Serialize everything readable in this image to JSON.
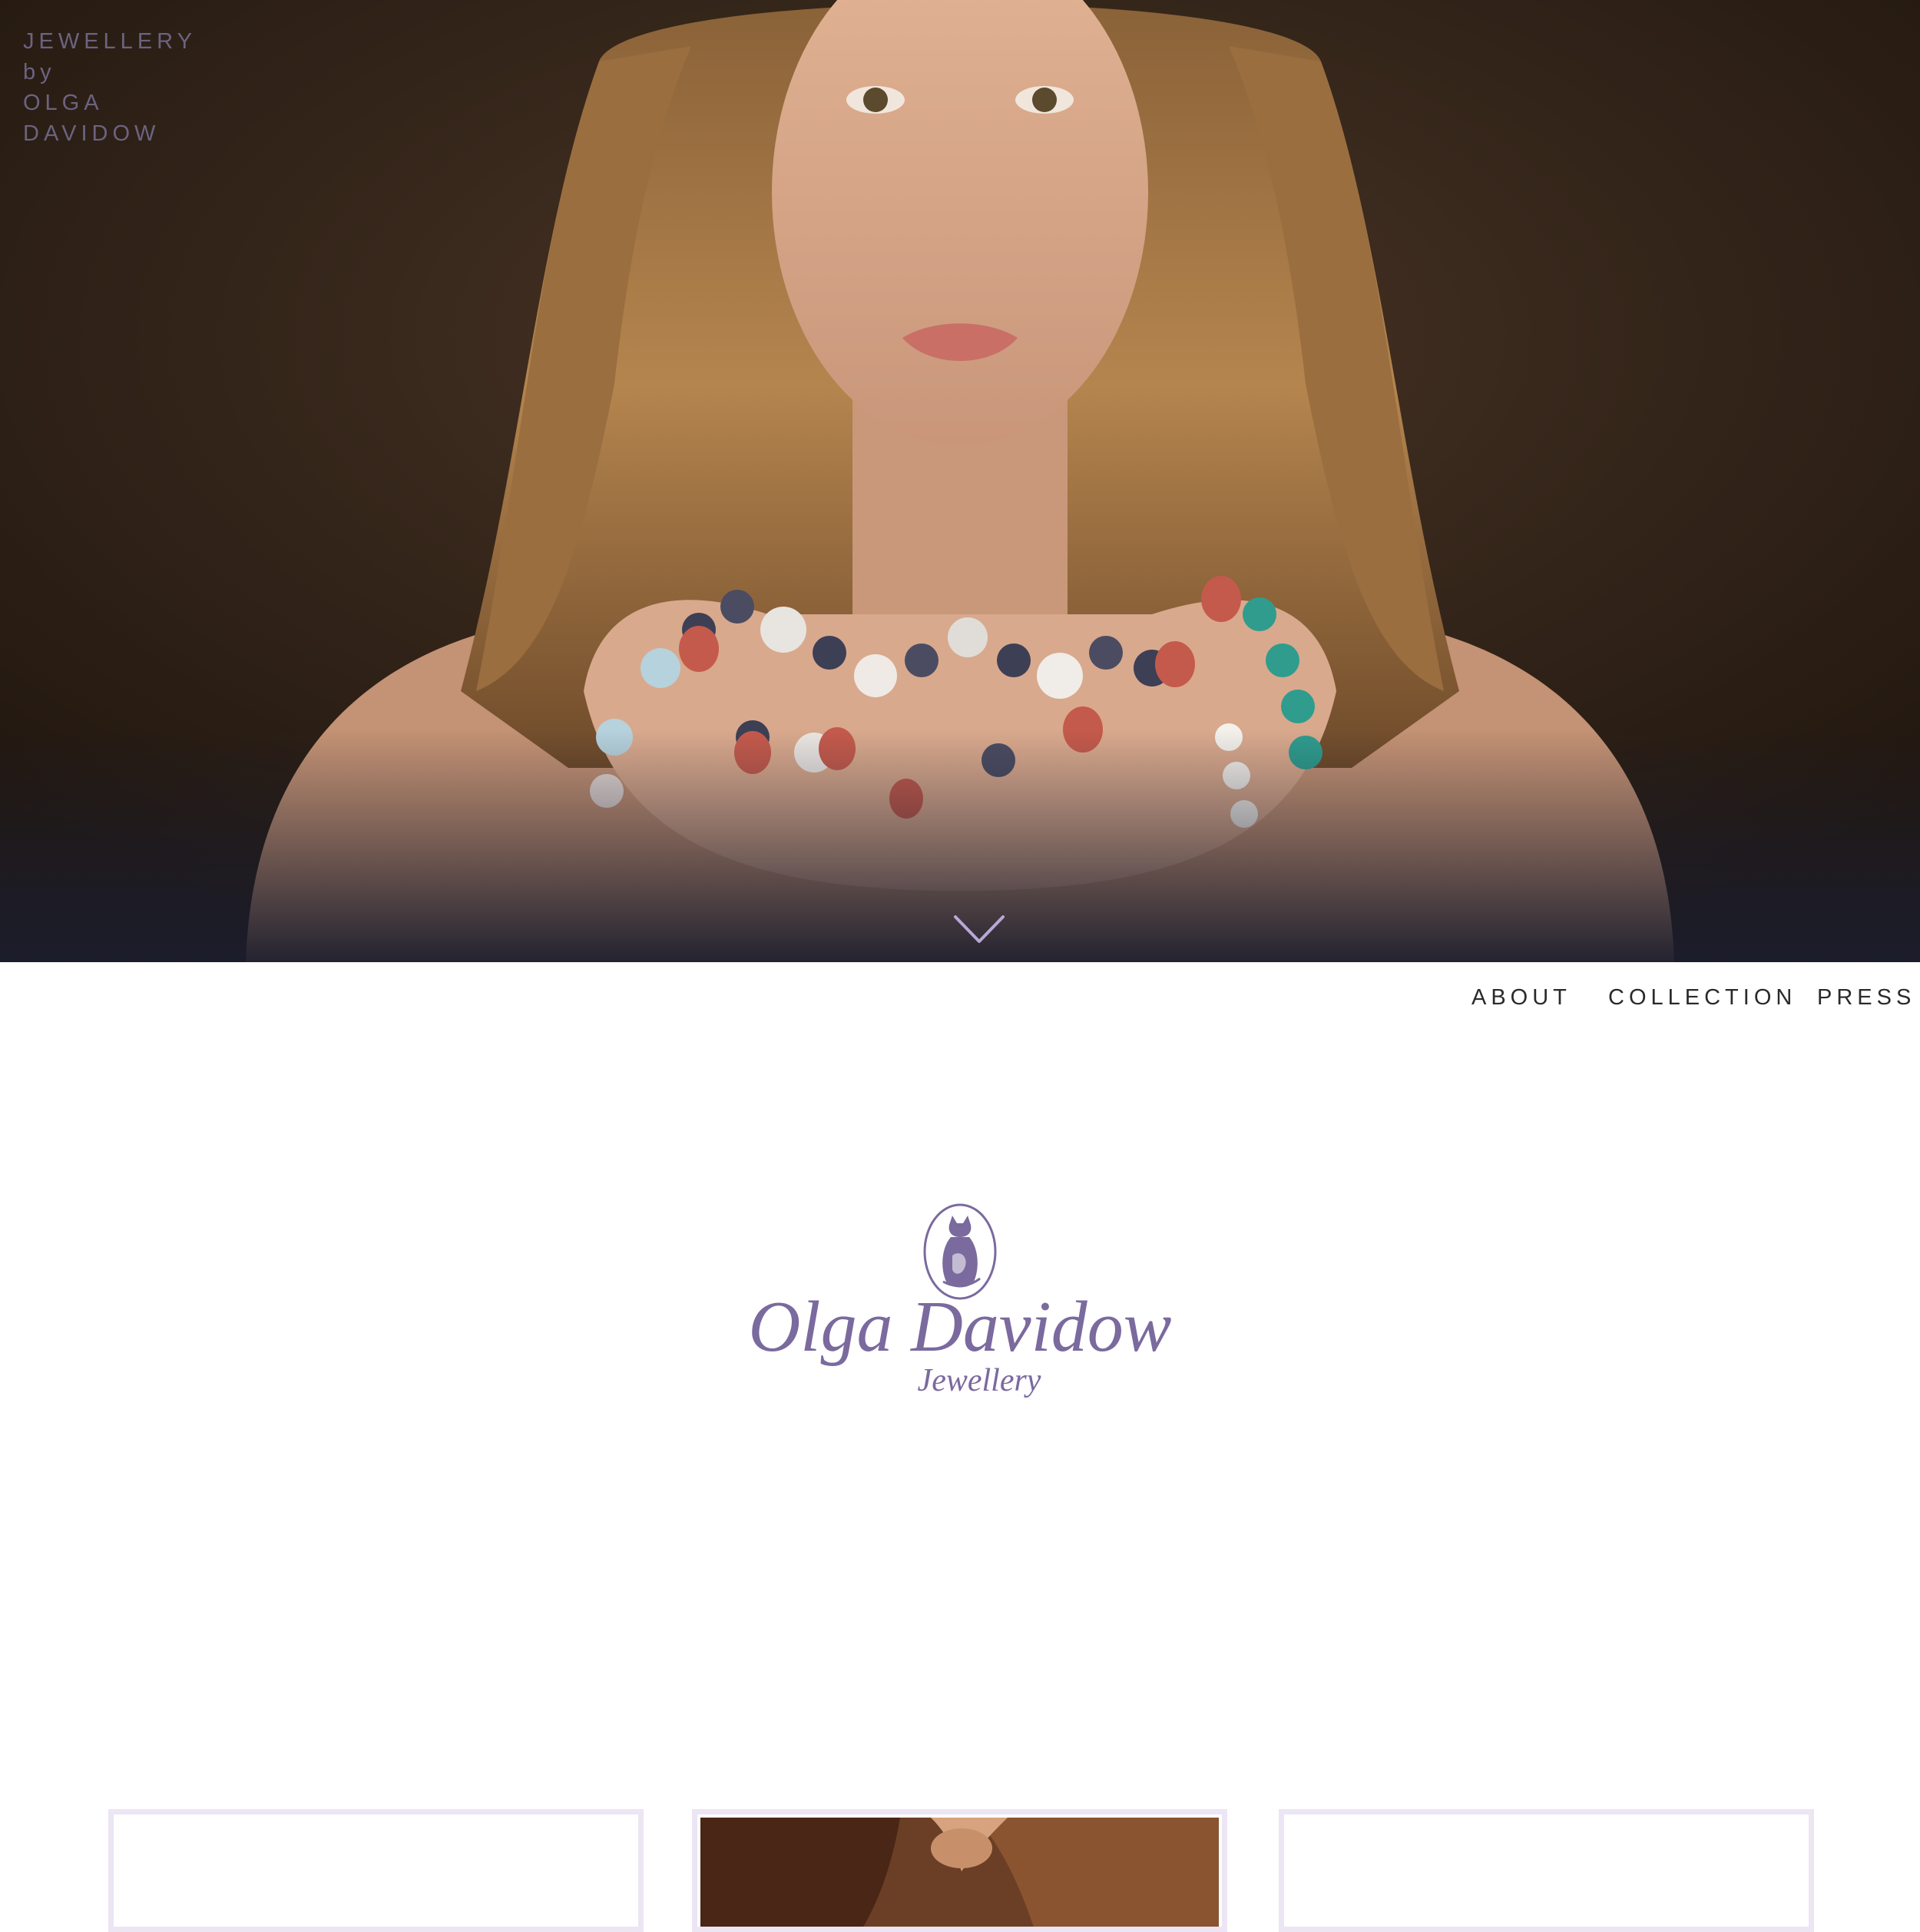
{
  "hero": {
    "brand_lines": [
      "JEWELLERY",
      "by",
      "OLGA",
      "DAVIDOW"
    ],
    "scroll_icon": "chevron-down-icon"
  },
  "nav": {
    "items": [
      {
        "label": "ABOUT"
      },
      {
        "label": "COLLECTION"
      },
      {
        "label": "PRESS"
      }
    ]
  },
  "logo": {
    "name": "Olga Davidow",
    "subtitle": "Jewellery",
    "emblem_icon": "cat-emblem-icon"
  },
  "cards": [
    {
      "has_image": false
    },
    {
      "has_image": true
    },
    {
      "has_image": false
    }
  ],
  "colors": {
    "brand_purple": "#7a6a9e",
    "brand_text_muted": "#6c6380",
    "card_border": "#ebe5f4",
    "nav_text": "#2a2a2a"
  }
}
